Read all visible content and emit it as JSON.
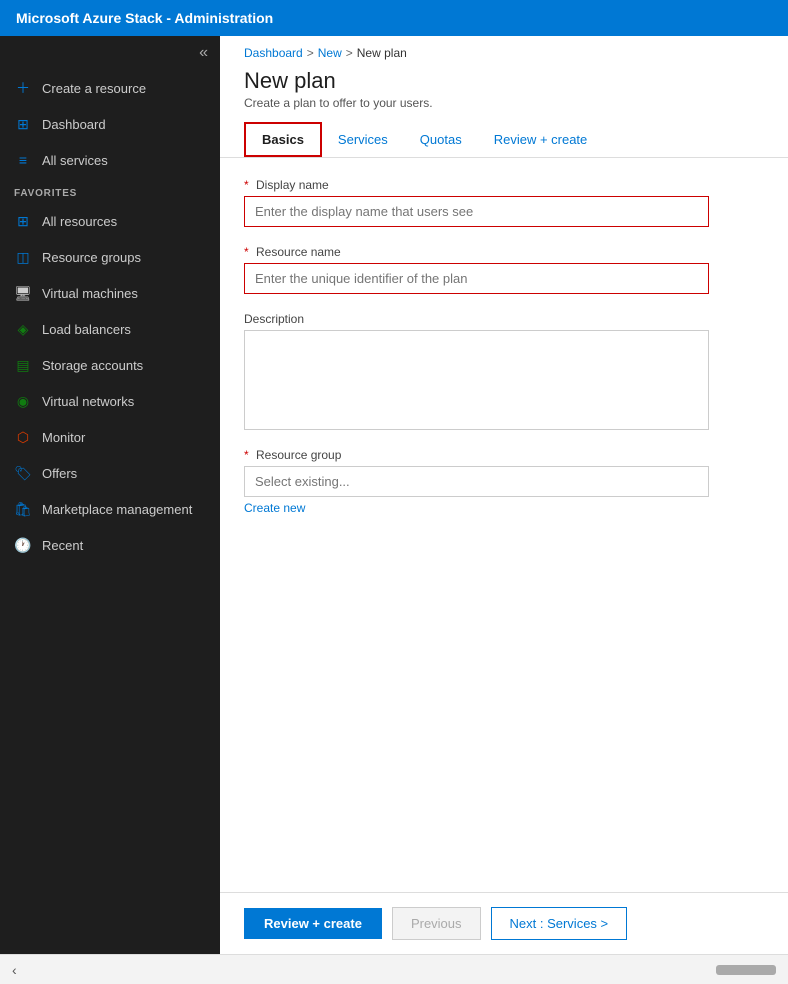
{
  "titleBar": {
    "label": "Microsoft Azure Stack - Administration"
  },
  "sidebar": {
    "collapseIcon": "«",
    "items": [
      {
        "id": "create-resource",
        "label": "Create a resource",
        "icon": "+",
        "iconClass": "icon-blue",
        "active": false
      },
      {
        "id": "dashboard",
        "label": "Dashboard",
        "icon": "⊞",
        "iconClass": "icon-blue",
        "active": false
      },
      {
        "id": "all-services",
        "label": "All services",
        "icon": "≡",
        "iconClass": "icon-blue",
        "active": false
      }
    ],
    "favoritesHeader": "FAVORITES",
    "favorites": [
      {
        "id": "all-resources",
        "label": "All resources",
        "icon": "⊞",
        "iconClass": "icon-blue"
      },
      {
        "id": "resource-groups",
        "label": "Resource groups",
        "icon": "◫",
        "iconClass": "icon-blue"
      },
      {
        "id": "virtual-machines",
        "label": "Virtual machines",
        "icon": "🖥",
        "iconClass": ""
      },
      {
        "id": "load-balancers",
        "label": "Load balancers",
        "icon": "⚖",
        "iconClass": "icon-green"
      },
      {
        "id": "storage-accounts",
        "label": "Storage accounts",
        "icon": "▤",
        "iconClass": "icon-green"
      },
      {
        "id": "virtual-networks",
        "label": "Virtual networks",
        "icon": "◉",
        "iconClass": "icon-green"
      },
      {
        "id": "monitor",
        "label": "Monitor",
        "icon": "⬡",
        "iconClass": "icon-orange"
      },
      {
        "id": "offers",
        "label": "Offers",
        "icon": "🏷",
        "iconClass": "icon-blue"
      },
      {
        "id": "marketplace-management",
        "label": "Marketplace management",
        "icon": "🛍",
        "iconClass": "icon-blue"
      },
      {
        "id": "recent",
        "label": "Recent",
        "icon": "🕐",
        "iconClass": "icon-blue"
      }
    ]
  },
  "breadcrumb": {
    "items": [
      "Dashboard",
      "New",
      "New plan"
    ],
    "separators": [
      ">",
      ">"
    ]
  },
  "pageHeader": {
    "title": "New plan",
    "subtitle": "Create a plan to offer to your users."
  },
  "tabs": [
    {
      "id": "basics",
      "label": "Basics",
      "active": true
    },
    {
      "id": "services",
      "label": "Services",
      "active": false
    },
    {
      "id": "quotas",
      "label": "Quotas",
      "active": false
    },
    {
      "id": "review-create",
      "label": "Review + create",
      "active": false
    }
  ],
  "form": {
    "displayNameLabel": "Display name",
    "displayNamePlaceholder": "Enter the display name that users see",
    "resourceNameLabel": "Resource name",
    "resourceNamePlaceholder": "Enter the unique identifier of the plan",
    "descriptionLabel": "Description",
    "resourceGroupLabel": "Resource group",
    "resourceGroupPlaceholder": "Select existing...",
    "createNewLabel": "Create new"
  },
  "footer": {
    "reviewCreateLabel": "Review + create",
    "previousLabel": "Previous",
    "nextLabel": "Next : Services >"
  },
  "bottomBar": {
    "chevron": "‹",
    "scrollIndicator": ""
  }
}
